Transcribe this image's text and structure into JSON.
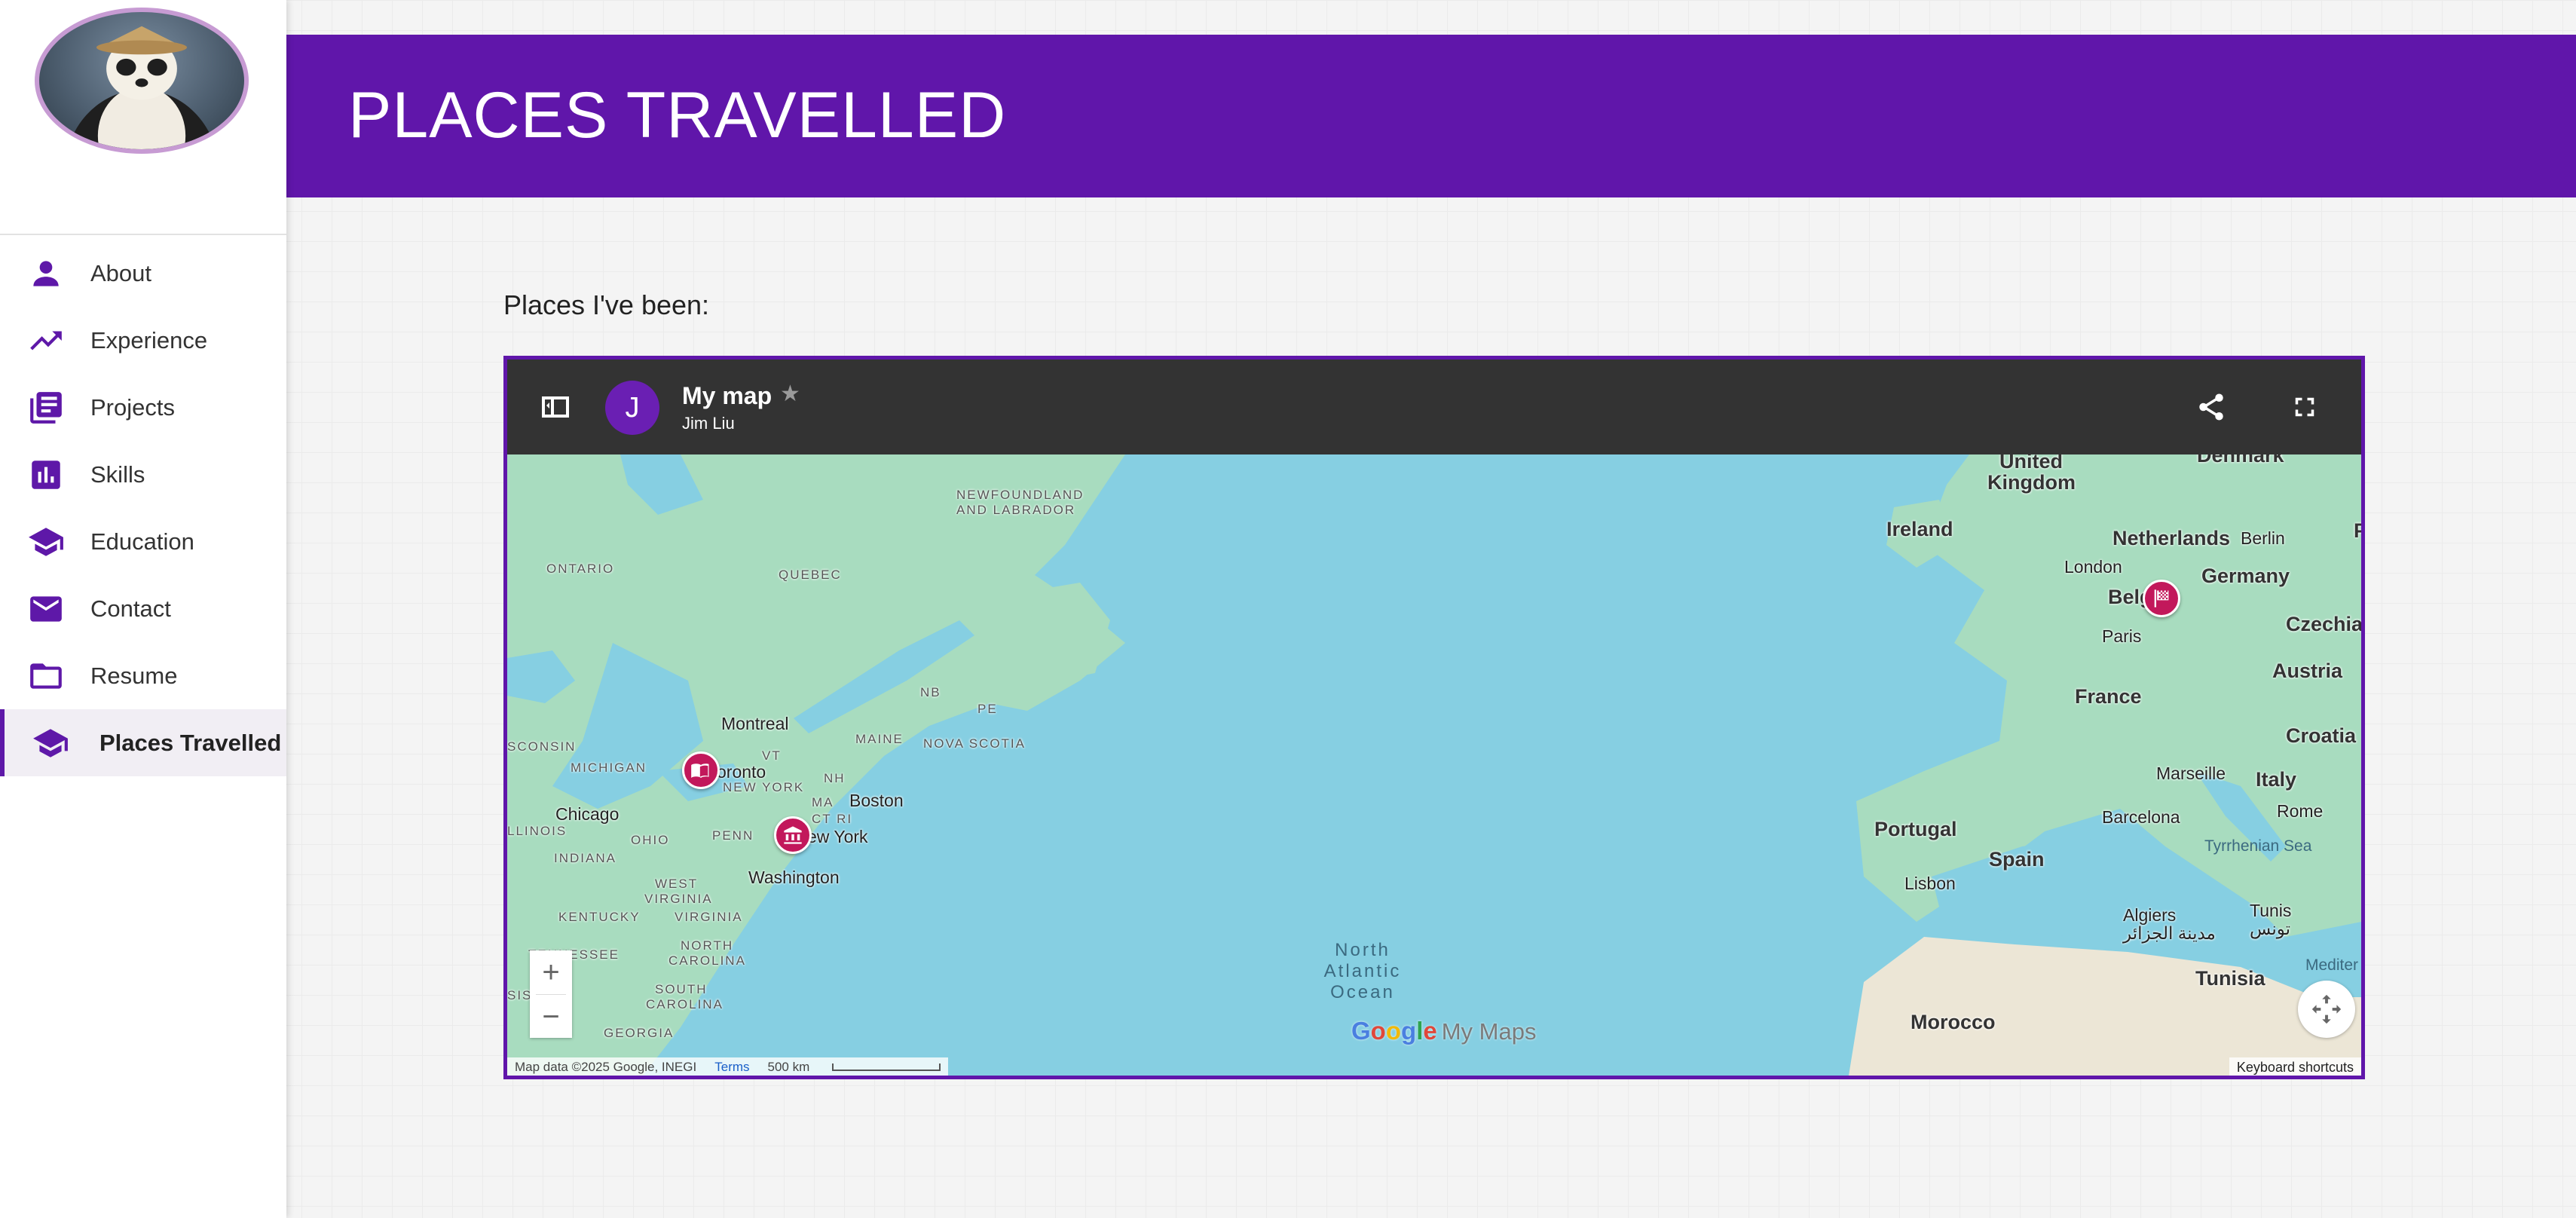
{
  "sidebar": {
    "avatar_icon": "panda-avatar",
    "items": [
      {
        "label": "About",
        "icon": "person-icon"
      },
      {
        "label": "Experience",
        "icon": "trending-up-icon"
      },
      {
        "label": "Projects",
        "icon": "article-icon"
      },
      {
        "label": "Skills",
        "icon": "bar-chart-icon"
      },
      {
        "label": "Education",
        "icon": "school-icon"
      },
      {
        "label": "Contact",
        "icon": "mail-icon"
      },
      {
        "label": "Resume",
        "icon": "folder-icon"
      },
      {
        "label": "Places Travelled",
        "icon": "school-icon",
        "active": true
      }
    ]
  },
  "header": {
    "title": "PLACES TRAVELLED"
  },
  "main": {
    "section_title": "Places I've been:"
  },
  "map": {
    "title": "My map",
    "owner": "Jim Liu",
    "owner_initial": "J",
    "labels": {
      "ontario": "ONTARIO",
      "quebec": "QUEBEC",
      "newfoundland1": "NEWFOUNDLAND",
      "newfoundland2": "AND LABRADOR",
      "nb": "NB",
      "pe": "PE",
      "maine": "MAINE",
      "nova_scotia": "NOVA SCOTIA",
      "vt": "VT",
      "nh": "NH",
      "ma": "MA",
      "ct_ri": "CT RI",
      "new_york_state": "NEW YORK",
      "michigan": "MICHIGAN",
      "wisconsin": "SCONSIN",
      "illinois": "LLINOIS",
      "indiana": "INDIANA",
      "ohio": "OHIO",
      "penn": "PENN",
      "west_virginia1": "WEST",
      "west_virginia2": "VIRGINIA",
      "virginia": "VIRGINIA",
      "kentucky": "KENTUCKY",
      "tennessee": "TENNESSEE",
      "north_carolina1": "NORTH",
      "north_carolina2": "CAROLINA",
      "south_carolina1": "SOUTH",
      "south_carolina2": "CAROLINA",
      "georgia": "GEORGIA",
      "sis": "SIS",
      "montreal": "Montreal",
      "toronto": "oronto",
      "chicago": "Chicago",
      "boston": "Boston",
      "new_york": "ew York",
      "washington": "Washington",
      "ocean1": "North",
      "ocean2": "Atlantic",
      "ocean3": "Ocean",
      "uk1": "United",
      "uk2": "Kingdom",
      "denmark": "Denmark",
      "ireland": "Ireland",
      "netherlands": "Netherlands",
      "berlin": "Berlin",
      "london": "London",
      "germany": "Germany",
      "belgium": "Belg",
      "paris": "Paris",
      "czechia": "Czechia",
      "p": "P",
      "austria": "Austria",
      "france": "France",
      "croatia": "Croatia",
      "marseille": "Marseille",
      "italy": "Italy",
      "barcelona": "Barcelona",
      "rome": "Rome",
      "portugal": "Portugal",
      "spain": "Spain",
      "tyrrhenian": "Tyrrhenian Sea",
      "lisbon": "Lisbon",
      "algiers": "Algiers",
      "algiers_ar": "مدينة الجزائر",
      "tunis": "Tunis",
      "tunis_ar": "تونس",
      "mediter": "Mediter",
      "tunisia": "Tunisia",
      "morocco": "Morocco"
    },
    "attribution": "Map data ©2025 Google, INEGI",
    "terms": "Terms",
    "scale": "500 km",
    "keyboard_shortcuts": "Keyboard shortcuts",
    "logo_google": "Google",
    "logo_mymaps": "My Maps",
    "zoom_in": "+",
    "zoom_out": "−",
    "colors": {
      "accent": "#6016aa",
      "water": "#86cfe2",
      "land": "#a8dcbf",
      "pin": "#c2185b"
    }
  }
}
